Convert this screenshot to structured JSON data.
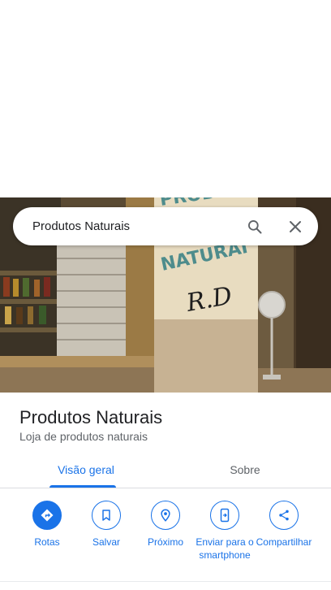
{
  "search": {
    "query": "Produtos Naturais",
    "search_icon": "search-icon",
    "close_icon": "close-icon"
  },
  "photo": {
    "sign_text_top": "PRODU",
    "sign_text_mid": "NATURAI",
    "graffiti": "R.D"
  },
  "place": {
    "name": "Produtos Naturais",
    "category": "Loja de produtos naturais"
  },
  "tabs": [
    {
      "label": "Visão geral",
      "active": true
    },
    {
      "label": "Sobre",
      "active": false
    }
  ],
  "actions": [
    {
      "label": "Rotas",
      "icon": "directions-icon"
    },
    {
      "label": "Salvar",
      "icon": "bookmark-icon"
    },
    {
      "label": "Próximo",
      "icon": "nearby-icon"
    },
    {
      "label": "Enviar para o smartphone",
      "icon": "send-to-phone-icon"
    },
    {
      "label": "Compartilhar",
      "icon": "share-icon"
    }
  ],
  "colors": {
    "accent": "#1a73e8",
    "text_primary": "#202124",
    "text_secondary": "#5f6368"
  }
}
